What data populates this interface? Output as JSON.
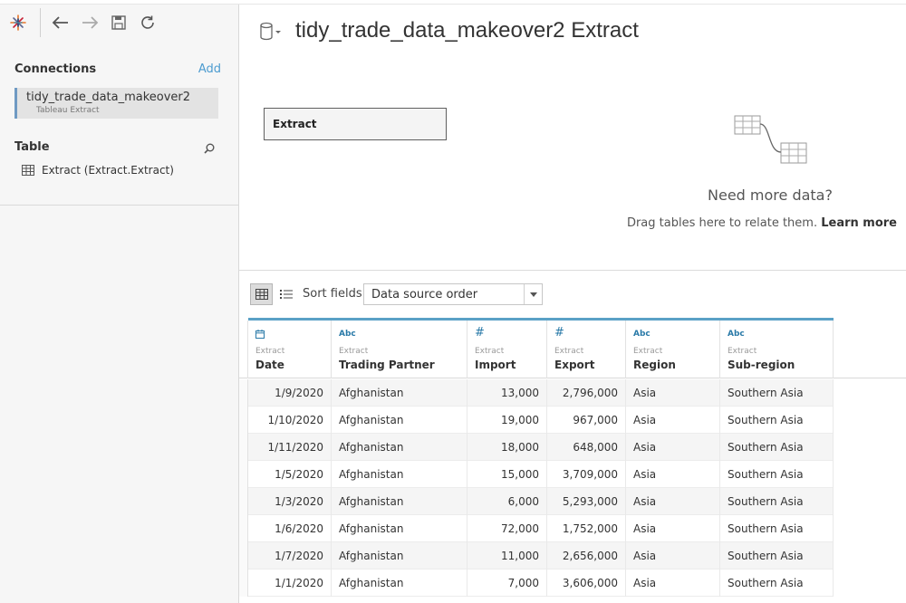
{
  "colors": {
    "accent": "#4d9cd0",
    "grid_top": "#5aa1c6",
    "type_icon": "#2a7aa8",
    "left_bg": "#f6f6f6"
  },
  "toolbar": {
    "icons": [
      "tableau-logo-icon",
      "back-arrow-icon",
      "forward-arrow-icon",
      "save-icon",
      "refresh-icon"
    ]
  },
  "connections": {
    "title": "Connections",
    "add_label": "Add",
    "items": [
      {
        "name": "tidy_trade_data_makeover2",
        "type": "Tableau Extract"
      }
    ]
  },
  "table_section": {
    "title": "Table",
    "items": [
      {
        "label": "Extract (Extract.Extract)"
      }
    ]
  },
  "datasource": {
    "title": "tidy_trade_data_makeover2 Extract"
  },
  "canvas": {
    "table_label": "Extract",
    "need_more_title": "Need more data?",
    "need_more_sub": "Drag tables here to relate them.",
    "learn_more": "Learn more"
  },
  "grid_toolbar": {
    "sort_label": "Sort fields",
    "sort_value": "Data source order"
  },
  "grid": {
    "columns": [
      {
        "type": "date-icon",
        "source": "Extract",
        "name": "Date"
      },
      {
        "type": "Abc",
        "source": "Extract",
        "name": "Trading Partner"
      },
      {
        "type": "#",
        "source": "Extract",
        "name": "Import"
      },
      {
        "type": "#",
        "source": "Extract",
        "name": "Export"
      },
      {
        "type": "Abc",
        "source": "Extract",
        "name": "Region"
      },
      {
        "type": "Abc",
        "source": "Extract",
        "name": "Sub-region"
      }
    ],
    "rows": [
      [
        "1/9/2020",
        "Afghanistan",
        "13,000",
        "2,796,000",
        "Asia",
        "Southern Asia"
      ],
      [
        "1/10/2020",
        "Afghanistan",
        "19,000",
        "967,000",
        "Asia",
        "Southern Asia"
      ],
      [
        "1/11/2020",
        "Afghanistan",
        "18,000",
        "648,000",
        "Asia",
        "Southern Asia"
      ],
      [
        "1/5/2020",
        "Afghanistan",
        "15,000",
        "3,709,000",
        "Asia",
        "Southern Asia"
      ],
      [
        "1/3/2020",
        "Afghanistan",
        "6,000",
        "5,293,000",
        "Asia",
        "Southern Asia"
      ],
      [
        "1/6/2020",
        "Afghanistan",
        "72,000",
        "1,752,000",
        "Asia",
        "Southern Asia"
      ],
      [
        "1/7/2020",
        "Afghanistan",
        "11,000",
        "2,656,000",
        "Asia",
        "Southern Asia"
      ],
      [
        "1/1/2020",
        "Afghanistan",
        "7,000",
        "3,606,000",
        "Asia",
        "Southern Asia"
      ]
    ]
  }
}
